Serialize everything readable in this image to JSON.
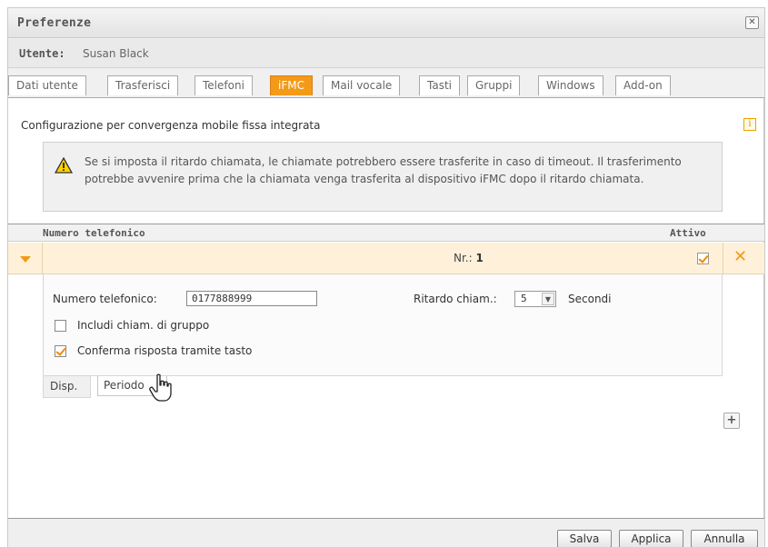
{
  "dialog": {
    "title": "Preferenze",
    "close_glyph": "✕",
    "close_icon": "close-icon"
  },
  "user": {
    "label": "Utente:",
    "name": "Susan Black"
  },
  "tabs": [
    {
      "label": "Dati utente",
      "active": false
    },
    {
      "label": "Trasferisci",
      "active": false
    },
    {
      "label": "Telefoni",
      "active": false
    },
    {
      "label": "iFMC",
      "active": true
    },
    {
      "label": "Mail vocale",
      "active": false
    },
    {
      "label": "Tasti",
      "active": false
    },
    {
      "label": "Gruppi",
      "active": false
    },
    {
      "label": "Windows",
      "active": false
    },
    {
      "label": "Add-on",
      "active": false
    }
  ],
  "content": {
    "config_title": "Configurazione per convergenza mobile fissa integrata",
    "info_glyph": "i",
    "info_icon": "info-icon",
    "warning_text": "Se si imposta il ritardo chiamata, le chiamate potrebbero essere trasferite in caso di timeout. Il trasferimento potrebbe avvenire prima che la chiamata venga trasferita al dispositivo iFMC dopo il ritardo chiamata.",
    "warning_icon": "warning-triangle-icon"
  },
  "table": {
    "header_number": "Numero telefonico",
    "header_active": "Attivo",
    "row": {
      "label_prefix": "Nr.:",
      "number": "1",
      "active": true,
      "delete_glyph": "✕"
    }
  },
  "detail": {
    "phone_label": "Numero telefonico:",
    "phone_value": "0177888999",
    "delay_label": "Ritardo chiam.:",
    "delay_value": "5",
    "delay_arrow": "▼",
    "delay_unit": "Secondi",
    "include_group_label": "Includi chiam. di gruppo",
    "include_group_checked": false,
    "confirm_key_label": "Conferma risposta tramite tasto",
    "confirm_key_checked": true
  },
  "sub_tabs": {
    "disp": "Disp.",
    "period": "Periodo"
  },
  "add_button_glyph": "+",
  "footer": {
    "save": "Salva",
    "apply": "Applica",
    "cancel": "Annulla"
  },
  "colors": {
    "accent": "#f39a18",
    "row_highlight": "#fff1d9"
  }
}
